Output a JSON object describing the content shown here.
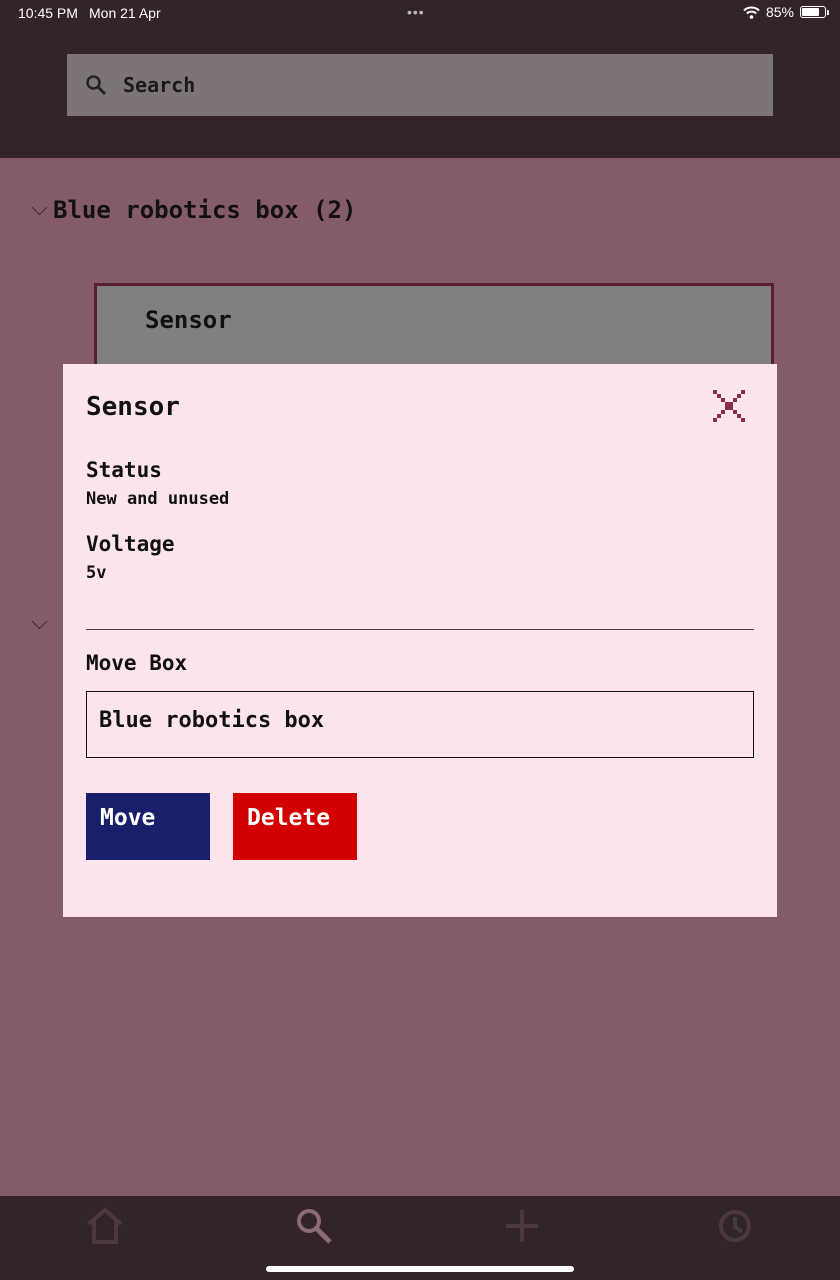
{
  "status_bar": {
    "time": "10:45 PM",
    "date": "Mon 21 Apr",
    "battery": "85%"
  },
  "search": {
    "placeholder": "Search",
    "icon": "search-icon"
  },
  "groups": [
    {
      "title": "Blue robotics box (2)",
      "expanded": true
    },
    {
      "title": "",
      "expanded": true
    }
  ],
  "item_card": {
    "name": "Sensor"
  },
  "modal": {
    "title": "Sensor",
    "close_icon": "close-icon",
    "fields": [
      {
        "label": "Status",
        "value": "New and unused"
      },
      {
        "label": "Voltage",
        "value": "5v"
      }
    ],
    "move_label": "Move Box",
    "move_value": "Blue robotics box",
    "move_button": "Move",
    "delete_button": "Delete"
  },
  "tabs": [
    "home-icon",
    "search-icon",
    "add-icon",
    "history-icon"
  ],
  "colors": {
    "header": "#33232b",
    "backdrop": "#835c67",
    "modal": "#fbe4ee",
    "move": "#1a1f6b",
    "delete": "#d20000",
    "accent": "#8b2c4a"
  }
}
